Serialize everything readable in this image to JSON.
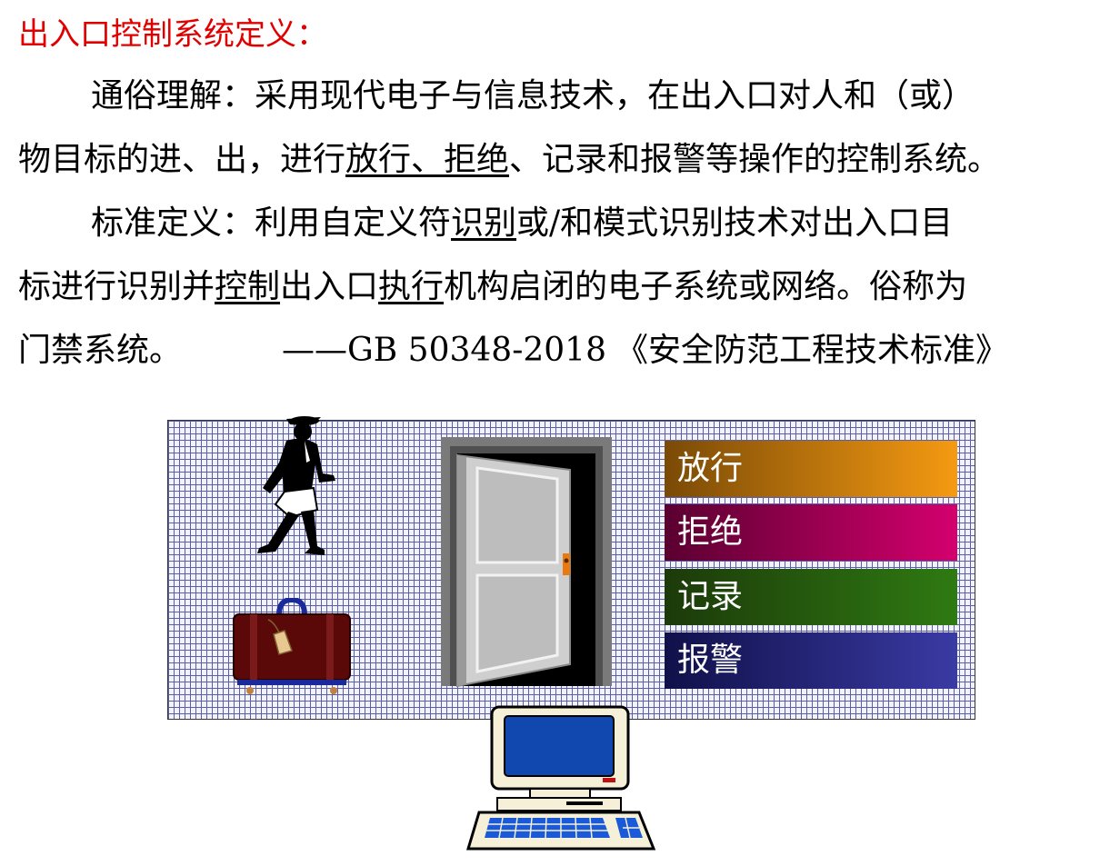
{
  "title": "出入口控制系统定义：",
  "popular": {
    "lead": "通俗理解：采用现代电子与信息技术，在出入口对人和（或）",
    "line2_pre": "物目标的进、出，进行",
    "line2_u": "放行、拒绝",
    "line2_post": "、记录和报警等操作的控制系统。"
  },
  "standard": {
    "l1_pre": "标准定义：利用自定义符",
    "l1_u": "识别",
    "l1_post": "或/和模式识别技术对出入口目",
    "l2_pre": "标进行识别并",
    "l2_u1": "控制",
    "l2_mid": "出入口",
    "l2_u2": "执行",
    "l2_post": "机构启闭的电子系统或网络。俗称为",
    "l3_pre": "门禁系统。",
    "l3_ref": "——GB 50348-2018",
    "l3_std": "《安全防范工程技术标准》"
  },
  "diagram": {
    "labels": [
      "放行",
      "拒绝",
      "记录",
      "报警"
    ],
    "colors": {
      "release": "#f59a12",
      "reject": "#d4006e",
      "record": "#2f7a12",
      "alarm": "#3a3aa4",
      "brick": "#5a5fa8"
    },
    "icons": [
      "walking-man-icon",
      "suitcase-icon",
      "open-door-icon",
      "computer-icon"
    ]
  }
}
